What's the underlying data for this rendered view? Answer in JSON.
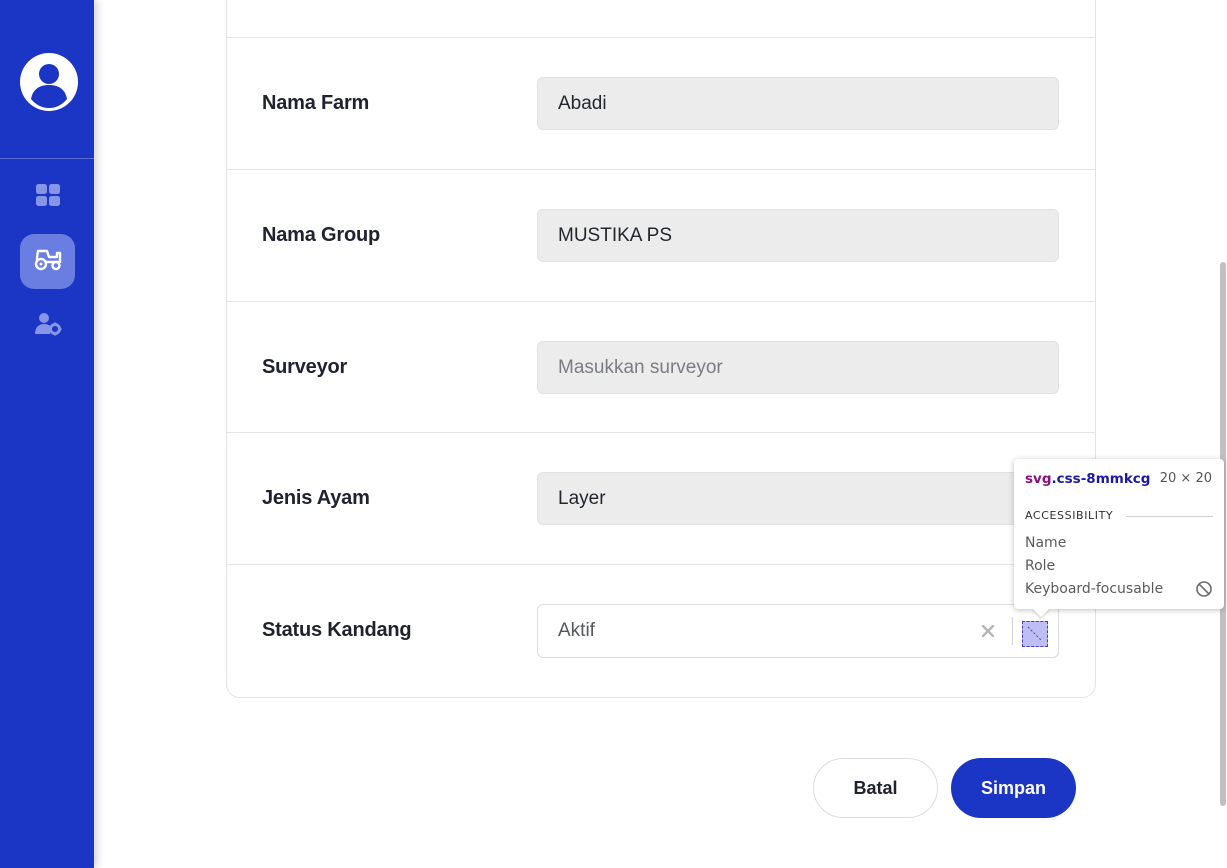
{
  "sidebar": {
    "icons": [
      "user-avatar-icon",
      "dashboard-grid-icon",
      "tractor-icon",
      "user-settings-icon"
    ],
    "active_item": "tractor",
    "color": "#1b35c4"
  },
  "form": {
    "fields": [
      {
        "label": "Nama Farm",
        "value": "Abadi",
        "placeholder": ""
      },
      {
        "label": "Nama Group",
        "value": "MUSTIKA PS",
        "placeholder": ""
      },
      {
        "label": "Surveyor",
        "value": "",
        "placeholder": "Masukkan surveyor"
      },
      {
        "label": "Jenis Ayam",
        "value": "Layer",
        "placeholder": ""
      },
      {
        "label": "Status Kandang",
        "value": "Aktif",
        "placeholder": ""
      }
    ]
  },
  "actions": {
    "cancel_label": "Batal",
    "save_label": "Simpan"
  },
  "devtools_tooltip": {
    "element": "svg",
    "class_name": ".css-8mmkcg",
    "size": "20 × 20",
    "section": "ACCESSIBILITY",
    "rows": [
      "Name",
      "Role",
      "Keyboard-focusable"
    ]
  }
}
